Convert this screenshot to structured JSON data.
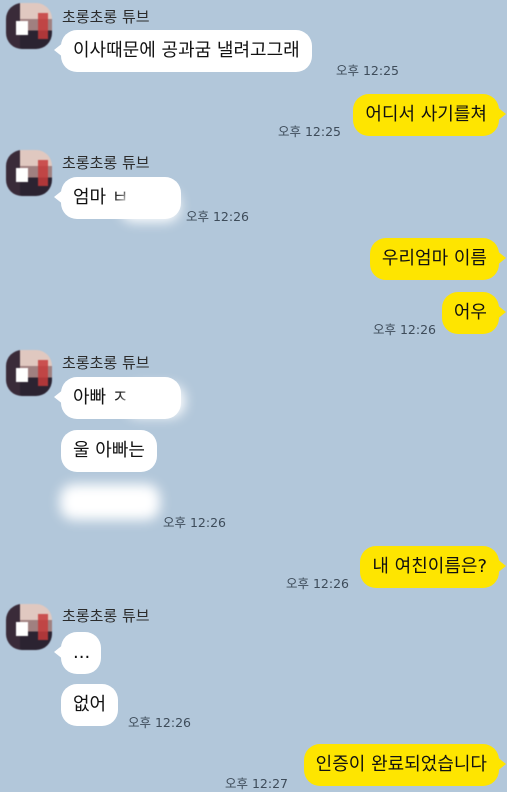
{
  "chat": {
    "sender_name": "초롱초롱 튜브",
    "msg1": "이사때문에 공과굼 낼려고그래",
    "time1": "오후 12:25",
    "msg2": "어디서 사기를쳐",
    "time2": "오후 12:25",
    "msg3": "엄마 ㅂ",
    "time3": "오후 12:26",
    "msg4": "우리엄마 이름",
    "msg5": "어우",
    "time5": "오후 12:26",
    "msg6": "아빠 ㅈ",
    "msg7": "울 아빠는",
    "time8": "오후 12:26",
    "msg9": "내 여친이름은?",
    "time9": "오후 12:26",
    "msg10": "...",
    "msg11": "없어",
    "time11": "오후 12:26",
    "msg12": "인증이 완료되었습니다",
    "time12": "오후 12:27"
  }
}
